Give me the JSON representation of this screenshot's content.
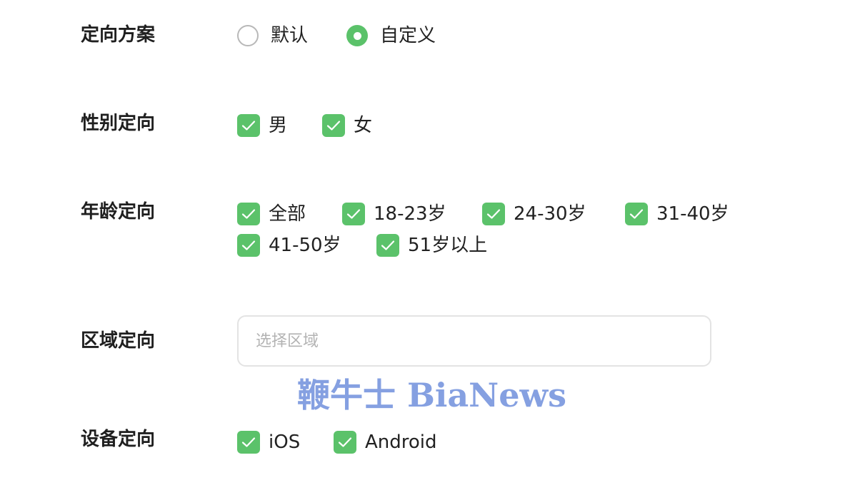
{
  "colors": {
    "accent": "#5bc26a",
    "radio_border": "#b8b8b8",
    "input_border": "#e3e3e3",
    "placeholder": "#b3b3b3",
    "watermark": "#7f9be0"
  },
  "strategy": {
    "label": "定向方案",
    "options": [
      {
        "label": "默认",
        "selected": false
      },
      {
        "label": "自定义",
        "selected": true
      }
    ]
  },
  "gender": {
    "label": "性别定向",
    "options": [
      {
        "label": "男",
        "checked": true
      },
      {
        "label": "女",
        "checked": true
      }
    ]
  },
  "age": {
    "label": "年龄定向",
    "options": [
      {
        "label": "全部",
        "checked": true
      },
      {
        "label": "18-23岁",
        "checked": true
      },
      {
        "label": "24-30岁",
        "checked": true
      },
      {
        "label": "31-40岁",
        "checked": true
      },
      {
        "label": "41-50岁",
        "checked": true
      },
      {
        "label": "51岁以上",
        "checked": true
      }
    ]
  },
  "region": {
    "label": "区域定向",
    "placeholder": "选择区域",
    "value": ""
  },
  "device": {
    "label": "设备定向",
    "options": [
      {
        "label": "iOS",
        "checked": true
      },
      {
        "label": "Android",
        "checked": true
      }
    ]
  },
  "watermark": {
    "text": "鞭牛士 BiaNews"
  },
  "icons": {
    "checkbox": "checkmark-icon",
    "radio_selected": "radio-selected-icon",
    "radio_unselected": "radio-unselected-icon"
  }
}
